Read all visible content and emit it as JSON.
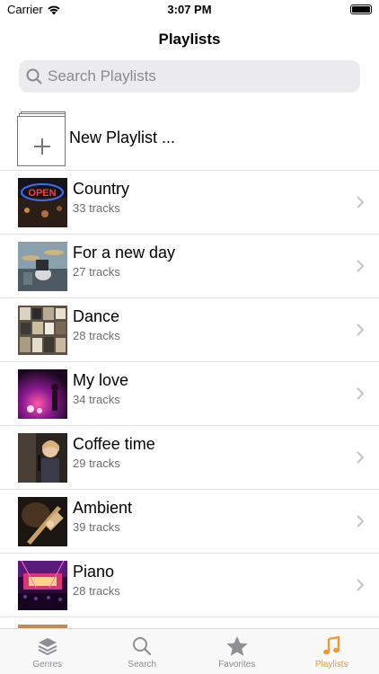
{
  "status_bar": {
    "carrier": "Carrier",
    "time": "3:07 PM",
    "battery_level": 1.0
  },
  "nav": {
    "title": "Playlists"
  },
  "search": {
    "placeholder": "Search Playlists",
    "value": ""
  },
  "new_playlist": {
    "label": "New Playlist ..."
  },
  "playlists": [
    {
      "title": "Country",
      "subtitle": "33 tracks",
      "thumb": "neon-sign"
    },
    {
      "title": "For a new day",
      "subtitle": "27 tracks",
      "thumb": "drum-kit"
    },
    {
      "title": "Dance",
      "subtitle": "28 tracks",
      "thumb": "record-wall"
    },
    {
      "title": "My love",
      "subtitle": "34 tracks",
      "thumb": "stage-lights"
    },
    {
      "title": "Coffee time",
      "subtitle": "29 tracks",
      "thumb": "child-singer"
    },
    {
      "title": "Ambient",
      "subtitle": "39 tracks",
      "thumb": "guitar"
    },
    {
      "title": "Piano",
      "subtitle": "28 tracks",
      "thumb": "concert-crowd"
    }
  ],
  "tabs": [
    {
      "label": "Genres",
      "icon": "layers-icon",
      "active": false
    },
    {
      "label": "Search",
      "icon": "search-icon",
      "active": false
    },
    {
      "label": "Favorites",
      "icon": "star-icon",
      "active": false
    },
    {
      "label": "Playlists",
      "icon": "music-note-icon",
      "active": true
    }
  ],
  "colors": {
    "accent": "#f29a2e",
    "inactive_tab": "#8e8e93",
    "search_bg": "#ececee"
  }
}
